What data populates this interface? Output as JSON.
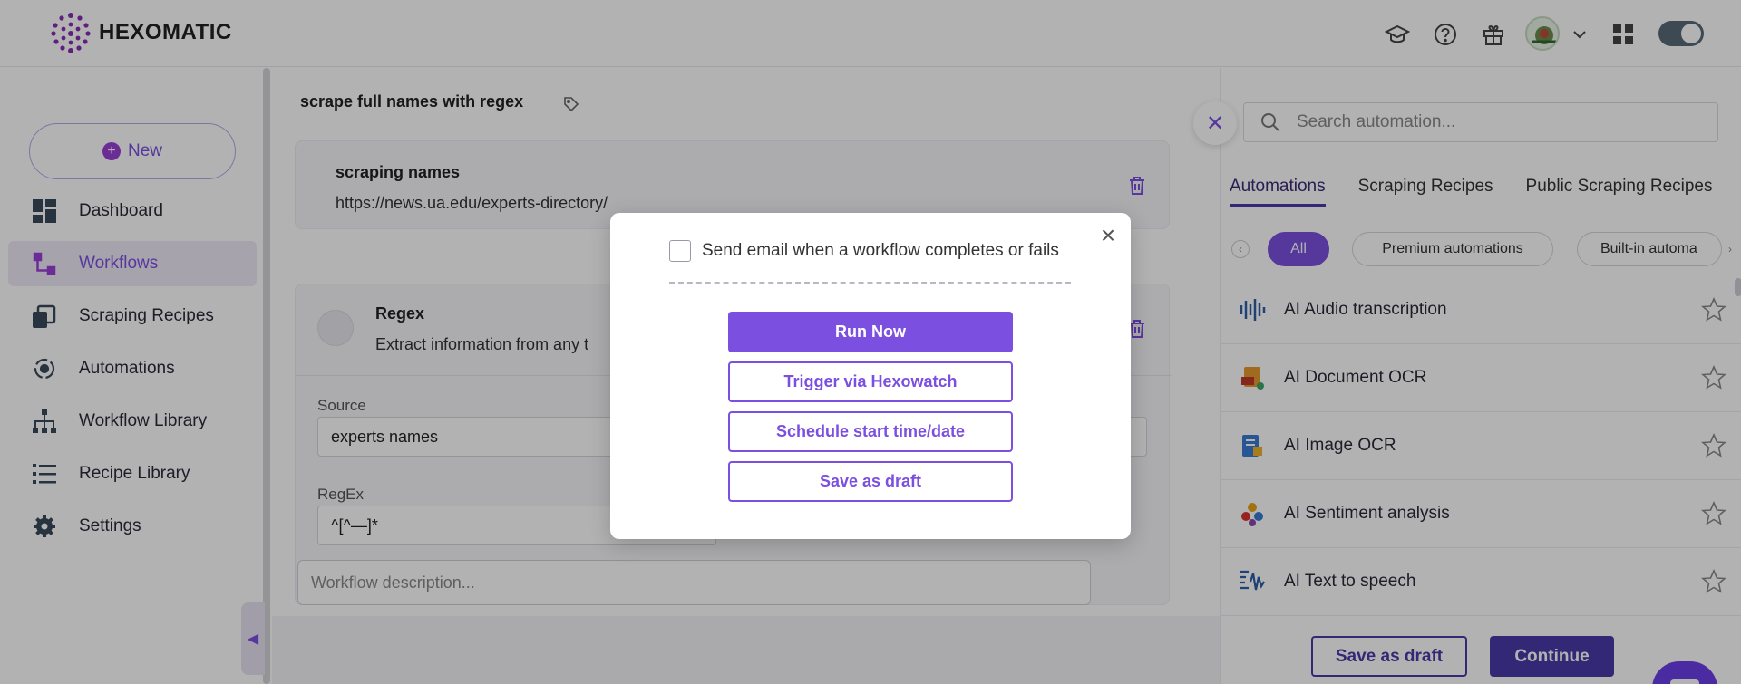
{
  "app": {
    "brand": "HEXOMATIC"
  },
  "sidebar": {
    "new_label": "New",
    "items": [
      {
        "label": "Dashboard",
        "icon": "dashboard-icon"
      },
      {
        "label": "Workflows",
        "icon": "workflow-icon"
      },
      {
        "label": "Scraping Recipes",
        "icon": "recipes-icon"
      },
      {
        "label": "Automations",
        "icon": "automation-icon"
      },
      {
        "label": "Workflow Library",
        "icon": "library-tree-icon"
      },
      {
        "label": "Recipe Library",
        "icon": "list-icon"
      },
      {
        "label": "Settings",
        "icon": "gear-icon"
      }
    ]
  },
  "workflow": {
    "title": "scrape full names with regex",
    "step1": {
      "title": "scraping names",
      "url": "https://news.ua.edu/experts-directory/"
    },
    "step2": {
      "title": "Regex",
      "desc": "Extract information from any t",
      "source_label": "Source",
      "source_value": "experts names",
      "regex_label": "RegEx",
      "regex_value": "^[^—]*"
    },
    "description_placeholder": "Workflow description..."
  },
  "right_panel": {
    "search_placeholder": "Search automation...",
    "tabs": [
      "Automations",
      "Scraping Recipes",
      "Public Scraping Recipes"
    ],
    "chips": [
      "All",
      "Premium automations",
      "Built-in automa"
    ],
    "items": [
      {
        "label": "AI Audio transcription",
        "icon": "audio-wave-icon"
      },
      {
        "label": "AI Document OCR",
        "icon": "document-icon"
      },
      {
        "label": "AI Image OCR",
        "icon": "image-doc-icon"
      },
      {
        "label": "AI Sentiment analysis",
        "icon": "sentiment-icon"
      },
      {
        "label": "AI Text to speech",
        "icon": "speech-wave-icon"
      }
    ]
  },
  "footer": {
    "save_draft": "Save as draft",
    "continue": "Continue"
  },
  "modal": {
    "checkbox_label": "Send email when a workflow completes or fails",
    "checkbox_checked": false,
    "run_now": "Run Now",
    "trigger": "Trigger via Hexowatch",
    "schedule": "Schedule start time/date",
    "save_draft": "Save as draft"
  },
  "colors": {
    "accent": "#7b4fe0",
    "dark_accent": "#4a3aa8"
  }
}
